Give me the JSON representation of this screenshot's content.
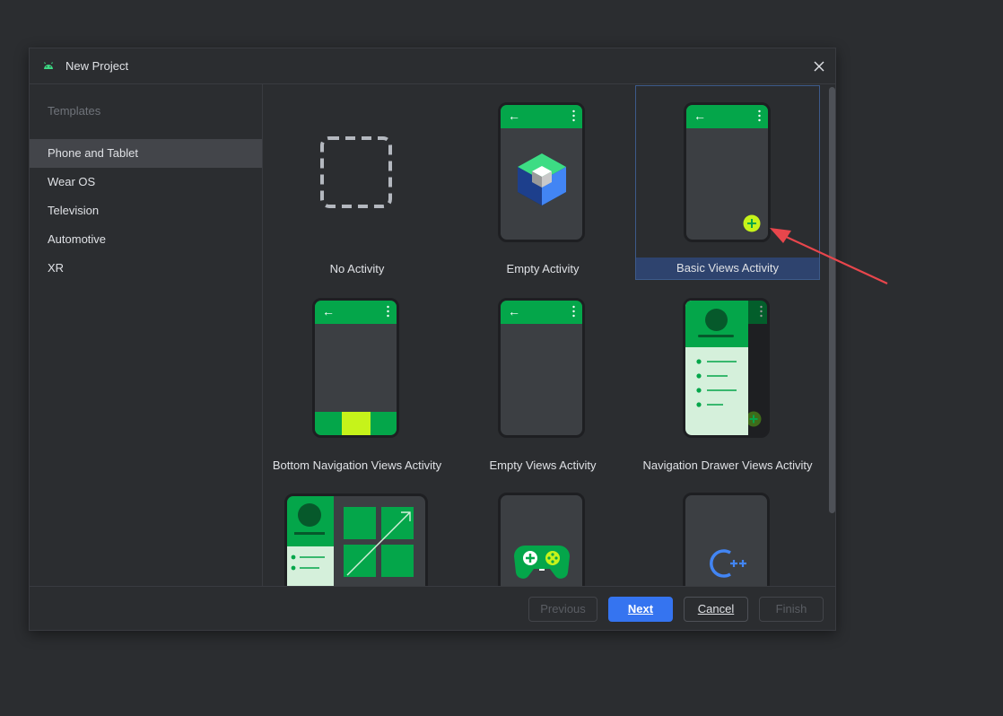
{
  "dialog": {
    "title": "New Project",
    "sidebar": {
      "header": "Templates",
      "items": [
        {
          "label": "Phone and Tablet",
          "selected": true
        },
        {
          "label": "Wear OS"
        },
        {
          "label": "Television"
        },
        {
          "label": "Automotive"
        },
        {
          "label": "XR"
        }
      ]
    },
    "templates": [
      {
        "label": "No Activity"
      },
      {
        "label": "Empty Activity"
      },
      {
        "label": "Basic Views Activity",
        "selected": true
      },
      {
        "label": "Bottom Navigation Views Activity"
      },
      {
        "label": "Empty Views Activity"
      },
      {
        "label": "Navigation Drawer Views Activity"
      }
    ],
    "footer": {
      "previous": "Previous",
      "next": "Next",
      "cancel": "Cancel",
      "finish": "Finish"
    }
  },
  "colors": {
    "background": "#2b2d30",
    "accent_green": "#04a64a",
    "fab_lime": "#c6f31a",
    "primary_button": "#3574f0",
    "selection": "#2e436e",
    "annotation_arrow": "#e8464c"
  }
}
